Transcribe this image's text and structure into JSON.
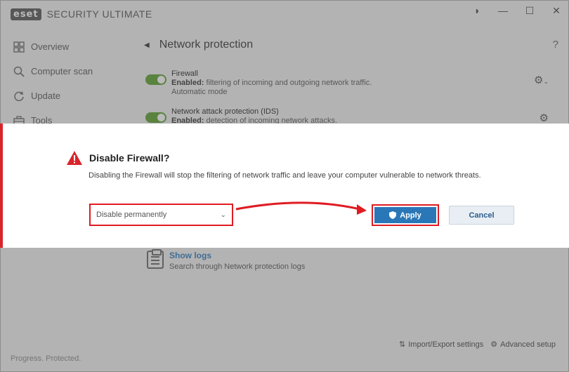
{
  "app": {
    "logo": "eset",
    "product": "SECURITY ULTIMATE",
    "window_buttons": [
      "◑",
      "—",
      "☐",
      "✕"
    ]
  },
  "sidebar": {
    "items": [
      {
        "label": "Overview",
        "icon": "overview-icon"
      },
      {
        "label": "Computer scan",
        "icon": "search-icon"
      },
      {
        "label": "Update",
        "icon": "update-icon"
      },
      {
        "label": "Tools",
        "icon": "toolbox-icon"
      }
    ],
    "status": "Progress. Protected."
  },
  "main": {
    "title": "Network protection",
    "features": [
      {
        "name": "Firewall",
        "desc_bold": "Enabled:",
        "desc": " filtering of incoming and outgoing network traffic.",
        "extra": "Automatic mode"
      },
      {
        "name": "Network attack protection (IDS)",
        "desc_bold": "Enabled:",
        "desc": " detection of incoming network attacks."
      }
    ],
    "show_logs": {
      "title": "Show logs",
      "desc": "Search through Network protection logs"
    },
    "bottom": {
      "import_export": "Import/Export settings",
      "advanced": "Advanced setup"
    }
  },
  "dialog": {
    "title": "Disable Firewall?",
    "description": "Disabling the Firewall will stop the filtering of network traffic and leave your computer vulnerable to network threats.",
    "select_value": "Disable permanently",
    "apply_label": "Apply",
    "cancel_label": "Cancel"
  },
  "colors": {
    "accent": "#2a77b8",
    "highlight": "#e01b22",
    "toggle_on": "#5aa12e",
    "warning": "#d9242b"
  }
}
